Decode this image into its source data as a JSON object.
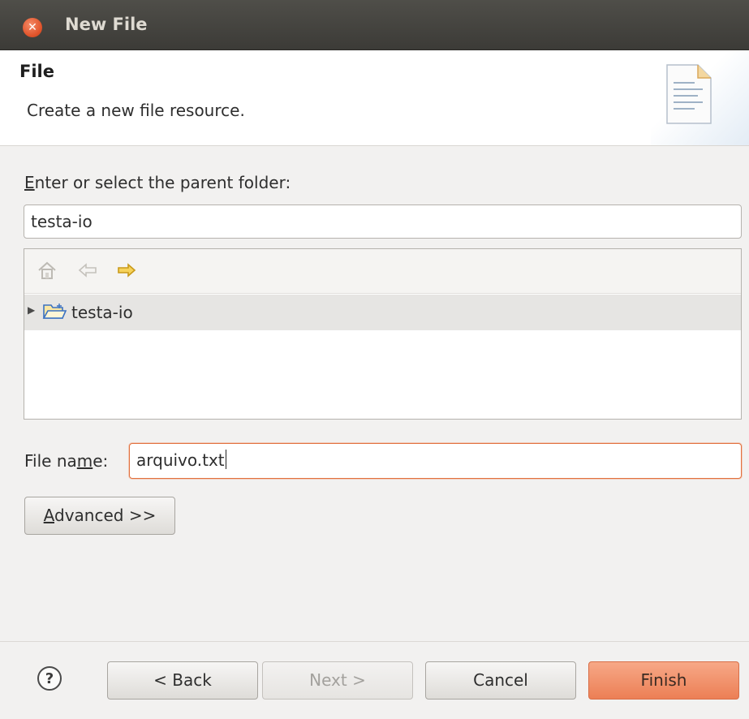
{
  "window": {
    "title": "New File"
  },
  "header": {
    "heading": "File",
    "description": "Create a new file resource.",
    "banner_icon": "document-icon"
  },
  "parent_folder": {
    "label_accel": "E",
    "label_rest": "nter or select the parent folder:",
    "value": "testa-io"
  },
  "tree": {
    "toolbar_icons": [
      "home-icon",
      "back-arrow-icon",
      "forward-arrow-icon"
    ],
    "items": [
      {
        "label": "testa-io",
        "expanded": false,
        "icon": "open-folder-icon",
        "selected": true
      }
    ]
  },
  "file_name": {
    "label_pre": "File na",
    "label_accel": "m",
    "label_post": "e:",
    "value": "arquivo.txt"
  },
  "buttons": {
    "advanced_accel": "A",
    "advanced_rest": "dvanced >>",
    "back": "< Back",
    "next": "Next >",
    "cancel": "Cancel",
    "finish": "Finish"
  },
  "colors": {
    "accent": "#ec7f55",
    "titlebar": "#3c3b37",
    "focus_border": "#e2713f"
  }
}
